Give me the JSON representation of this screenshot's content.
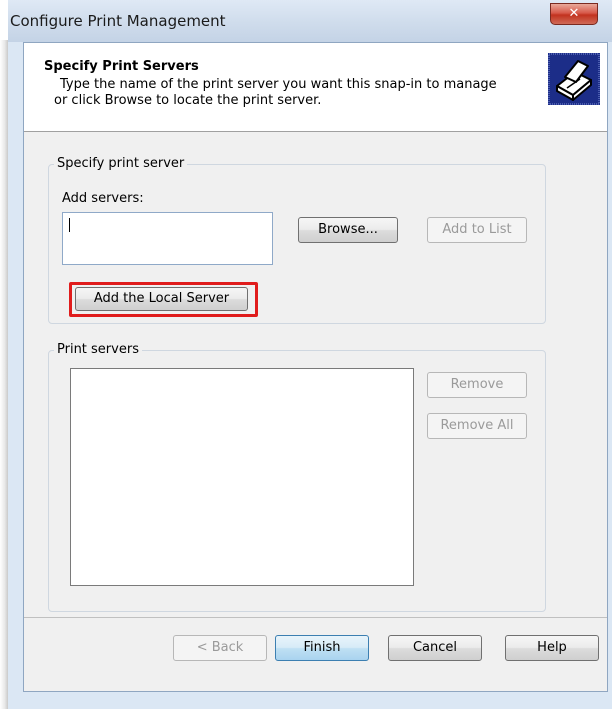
{
  "window": {
    "title": "Configure Print Management",
    "close_glyph": "✕"
  },
  "header": {
    "title": "Specify Print Servers",
    "subtitle_line1": "Type the name of the print server you want this snap-in to manage",
    "subtitle_line2": "or click Browse to locate the print server.",
    "icon": "printer-icon"
  },
  "specify_group": {
    "label": "Specify print server",
    "add_servers_label": "Add servers:",
    "server_input_value": "",
    "browse_label": "Browse...",
    "add_to_list_label": "Add to List",
    "add_local_label": "Add the Local Server"
  },
  "servers_group": {
    "label": "Print servers",
    "items": [],
    "remove_label": "Remove",
    "remove_all_label": "Remove All"
  },
  "footer": {
    "back_label": "< Back",
    "finish_label": "Finish",
    "cancel_label": "Cancel",
    "help_label": "Help"
  },
  "colors": {
    "highlight": "#e01c1c",
    "icon_bg": "#1c2d88"
  }
}
